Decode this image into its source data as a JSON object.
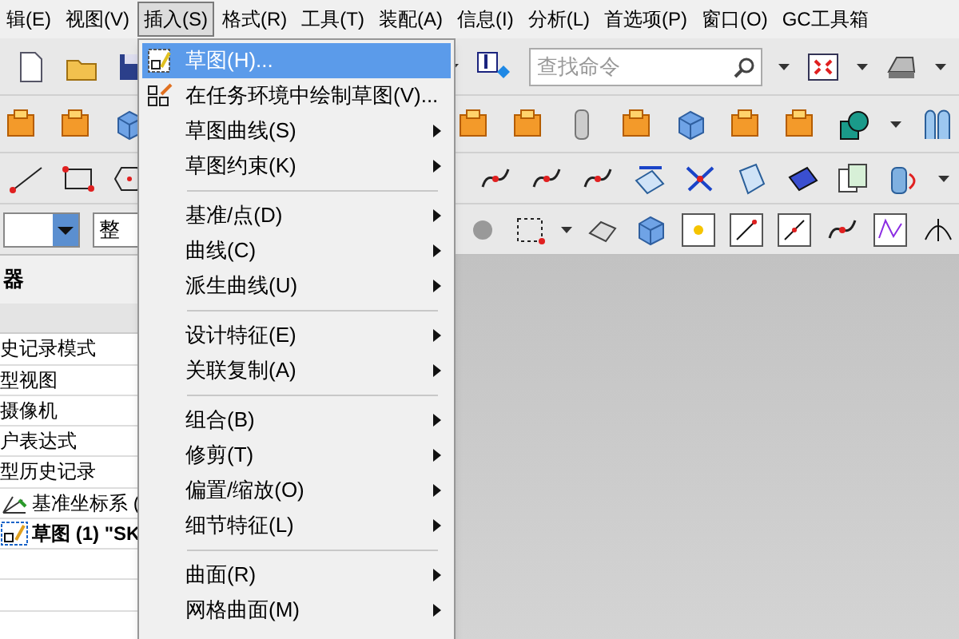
{
  "menu_bar": [
    {
      "label": "辑(E)",
      "selected": false
    },
    {
      "label": "视图(V)",
      "selected": false
    },
    {
      "label": "插入(S)",
      "selected": true
    },
    {
      "label": "格式(R)",
      "selected": false
    },
    {
      "label": "工具(T)",
      "selected": false
    },
    {
      "label": "装配(A)",
      "selected": false
    },
    {
      "label": "信息(I)",
      "selected": false
    },
    {
      "label": "分析(L)",
      "selected": false
    },
    {
      "label": "首选项(P)",
      "selected": false
    },
    {
      "label": "窗口(O)",
      "selected": false
    },
    {
      "label": "GC工具箱",
      "selected": false
    }
  ],
  "search": {
    "placeholder": "查找命令"
  },
  "filter_field": {
    "value": "整"
  },
  "navigator": {
    "title": "器",
    "rows": [
      {
        "label": "史记录模式",
        "kind": "text",
        "current": false
      },
      {
        "label": "型视图",
        "kind": "text",
        "current": false
      },
      {
        "label": "摄像机",
        "kind": "text",
        "current": false
      },
      {
        "label": "户表达式",
        "kind": "text",
        "current": false
      },
      {
        "label": "型历史记录",
        "kind": "text",
        "current": false
      },
      {
        "label": "基准坐标系 (",
        "kind": "datum",
        "current": false
      },
      {
        "label": "草图 (1) \"SK",
        "kind": "sketch",
        "current": true
      }
    ]
  },
  "insert_menu": {
    "items": [
      {
        "kind": "item",
        "label": "草图(H)...",
        "submenu": false,
        "selected": true
      },
      {
        "kind": "item",
        "label": "在任务环境中绘制草图(V)...",
        "submenu": false,
        "selected": false
      },
      {
        "kind": "item",
        "label": "草图曲线(S)",
        "submenu": true,
        "selected": false
      },
      {
        "kind": "item",
        "label": "草图约束(K)",
        "submenu": true,
        "selected": false
      },
      {
        "kind": "separator"
      },
      {
        "kind": "item",
        "label": "基准/点(D)",
        "submenu": true,
        "selected": false
      },
      {
        "kind": "item",
        "label": "曲线(C)",
        "submenu": true,
        "selected": false
      },
      {
        "kind": "item",
        "label": "派生曲线(U)",
        "submenu": true,
        "selected": false
      },
      {
        "kind": "separator"
      },
      {
        "kind": "item",
        "label": "设计特征(E)",
        "submenu": true,
        "selected": false
      },
      {
        "kind": "item",
        "label": "关联复制(A)",
        "submenu": true,
        "selected": false
      },
      {
        "kind": "separator"
      },
      {
        "kind": "item",
        "label": "组合(B)",
        "submenu": true,
        "selected": false
      },
      {
        "kind": "item",
        "label": "修剪(T)",
        "submenu": true,
        "selected": false
      },
      {
        "kind": "item",
        "label": "偏置/缩放(O)",
        "submenu": true,
        "selected": false
      },
      {
        "kind": "item",
        "label": "细节特征(L)",
        "submenu": true,
        "selected": false
      },
      {
        "kind": "separator"
      },
      {
        "kind": "item",
        "label": "曲面(R)",
        "submenu": true,
        "selected": false
      },
      {
        "kind": "item",
        "label": "网格曲面(M)",
        "submenu": true,
        "selected": false
      }
    ]
  }
}
